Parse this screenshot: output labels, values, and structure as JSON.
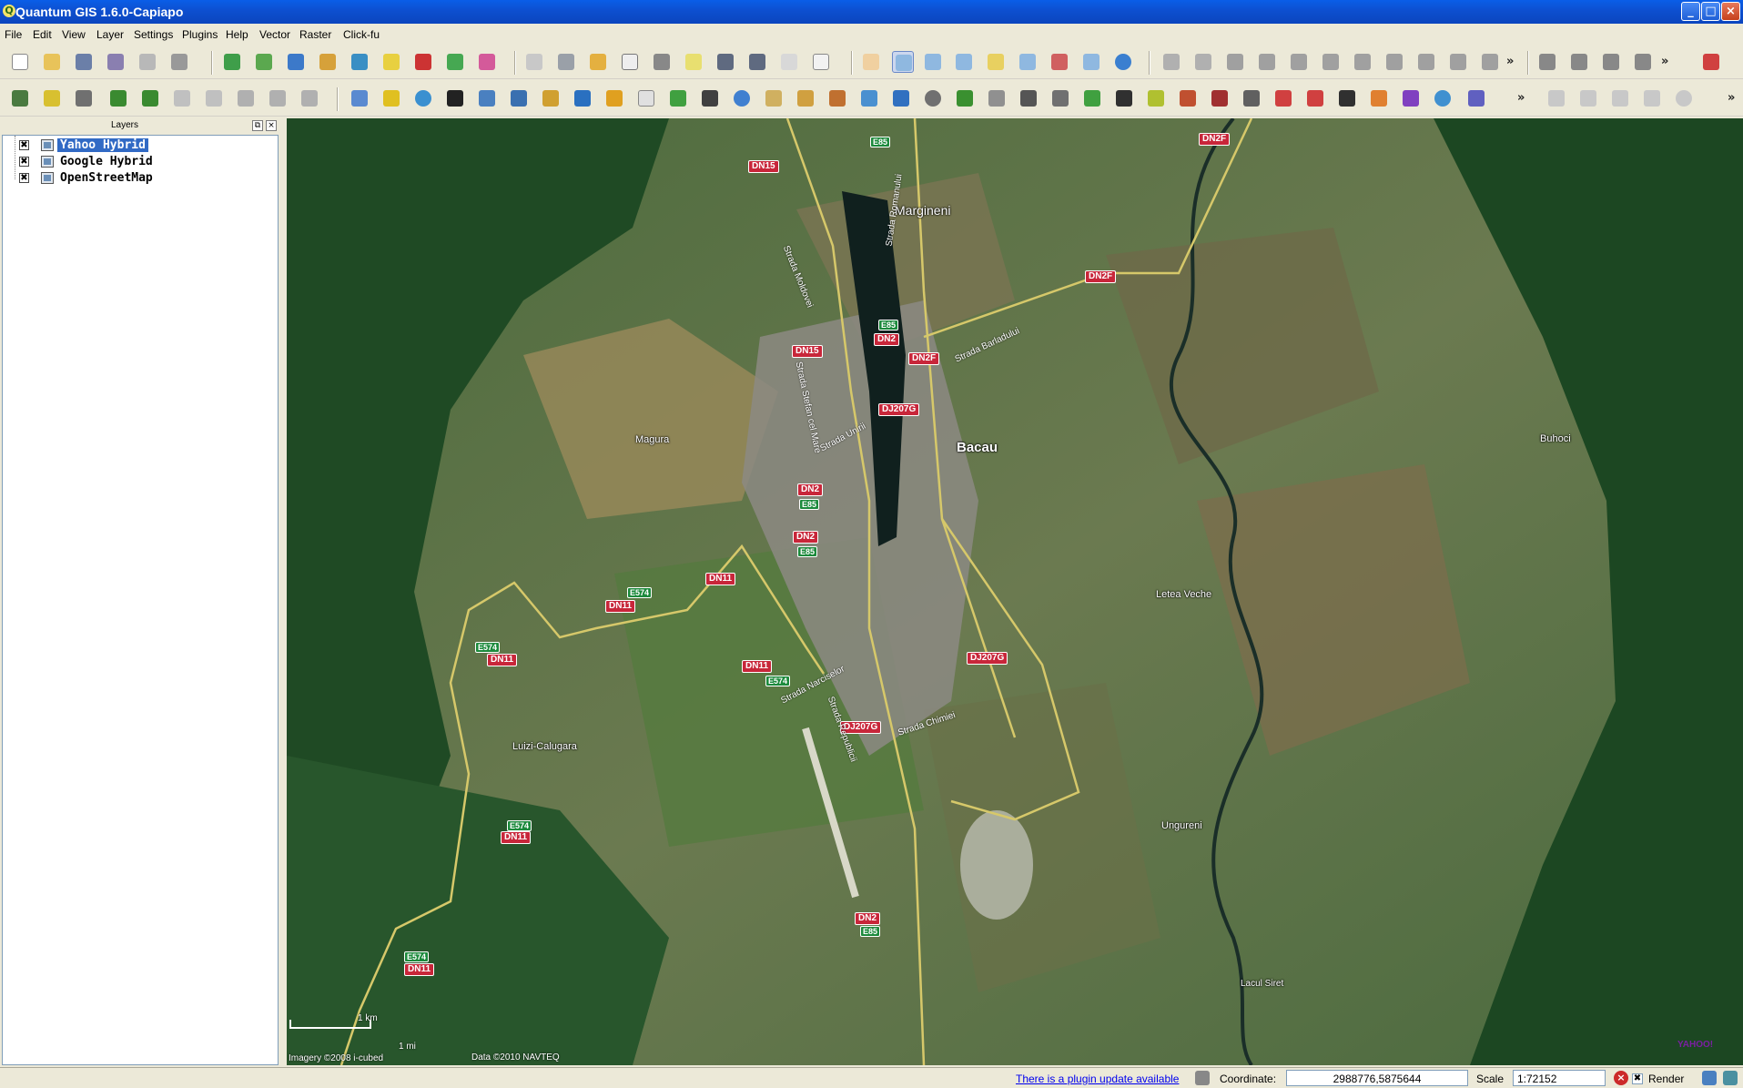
{
  "window": {
    "title": "Quantum GIS 1.6.0-Capiapo",
    "min_label": "_",
    "max_label": "□",
    "close_label": "×"
  },
  "menu": [
    "File",
    "Edit",
    "View",
    "Layer",
    "Settings",
    "Plugins",
    "Help",
    "Vector",
    "Raster",
    "Click-fu"
  ],
  "toolbar_overflow": "»",
  "layers_panel": {
    "title": "Layers",
    "float_label": "⧉",
    "close_label": "×",
    "layers": [
      {
        "name": "Yahoo Hybrid",
        "checked": "✖",
        "selected": true
      },
      {
        "name": "Google Hybrid",
        "checked": "✖",
        "selected": false
      },
      {
        "name": "OpenStreetMap",
        "checked": "✖",
        "selected": false
      }
    ]
  },
  "map": {
    "roads": [
      "DN15",
      "DN15",
      "DN2F",
      "DN2F",
      "DN2F",
      "DN2",
      "DN2",
      "DN2",
      "DN2",
      "DJ207G",
      "DJ207G",
      "DJ207G",
      "DN11",
      "DN11",
      "DN11",
      "DN11",
      "DN11",
      "DN11"
    ],
    "euro_routes": [
      "E85",
      "E85",
      "E85",
      "E85",
      "E85",
      "E574",
      "E574",
      "E574",
      "E574",
      "E574"
    ],
    "places": {
      "margineni": "Margineni",
      "magura": "Magura",
      "bacau": "Bacau",
      "buhoci": "Buhoci",
      "letea_veche": "Letea Veche",
      "luizi_calugara": "Luizi-Calugara",
      "ungureni": "Ungureni",
      "lacul_siret": "Lacul Siret"
    },
    "streets": {
      "moldovei": "Strada Moldovei",
      "romanului": "Strada Romanului",
      "barladului": "Strada Barladului",
      "stefan": "Strada Stefan cel Mare",
      "unirii": "Strada Unirii",
      "narciselor": "Strada Narciselor",
      "republicii": "Strada Republicii",
      "chimiei": "Strada Chimiei"
    },
    "scale_km": "1 km",
    "scale_mi": "1 mi",
    "imagery_credit": "Imagery ©2008 i-cubed",
    "data_credit": "Data ©2010 NAVTEQ",
    "yahoo_logo": "YAHOO!"
  },
  "statusbar": {
    "plugin_update": "There is a plugin update available",
    "coordinate_label": "Coordinate:",
    "coordinate_value": "2988776,5875644",
    "scale_label": "Scale",
    "scale_value": "1:72152",
    "render_label": "Render",
    "render_checked": "✖"
  }
}
